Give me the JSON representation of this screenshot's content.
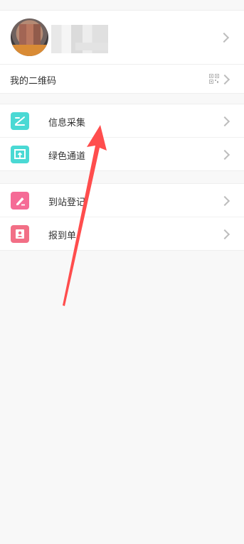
{
  "profile": {
    "name_redacted": true
  },
  "qr_row": {
    "label": "我的二维码"
  },
  "group1": {
    "items": [
      {
        "label": "信息采集",
        "icon": "form-edit-icon",
        "color": "#4ad9d4"
      },
      {
        "label": "绿色通道",
        "icon": "green-channel-icon",
        "color": "#4ad9d4"
      }
    ]
  },
  "group2": {
    "items": [
      {
        "label": "到站登记",
        "icon": "pencil-icon",
        "color": "#f56b96"
      },
      {
        "label": "报到单",
        "icon": "id-card-icon",
        "color": "#f26f86"
      }
    ]
  },
  "colors": {
    "teal": "#4ad9d4",
    "pink": "#f56b96",
    "annotation_arrow": "#ff4d4d",
    "chevron": "#bdbdbd",
    "background": "#f8f8f8"
  }
}
